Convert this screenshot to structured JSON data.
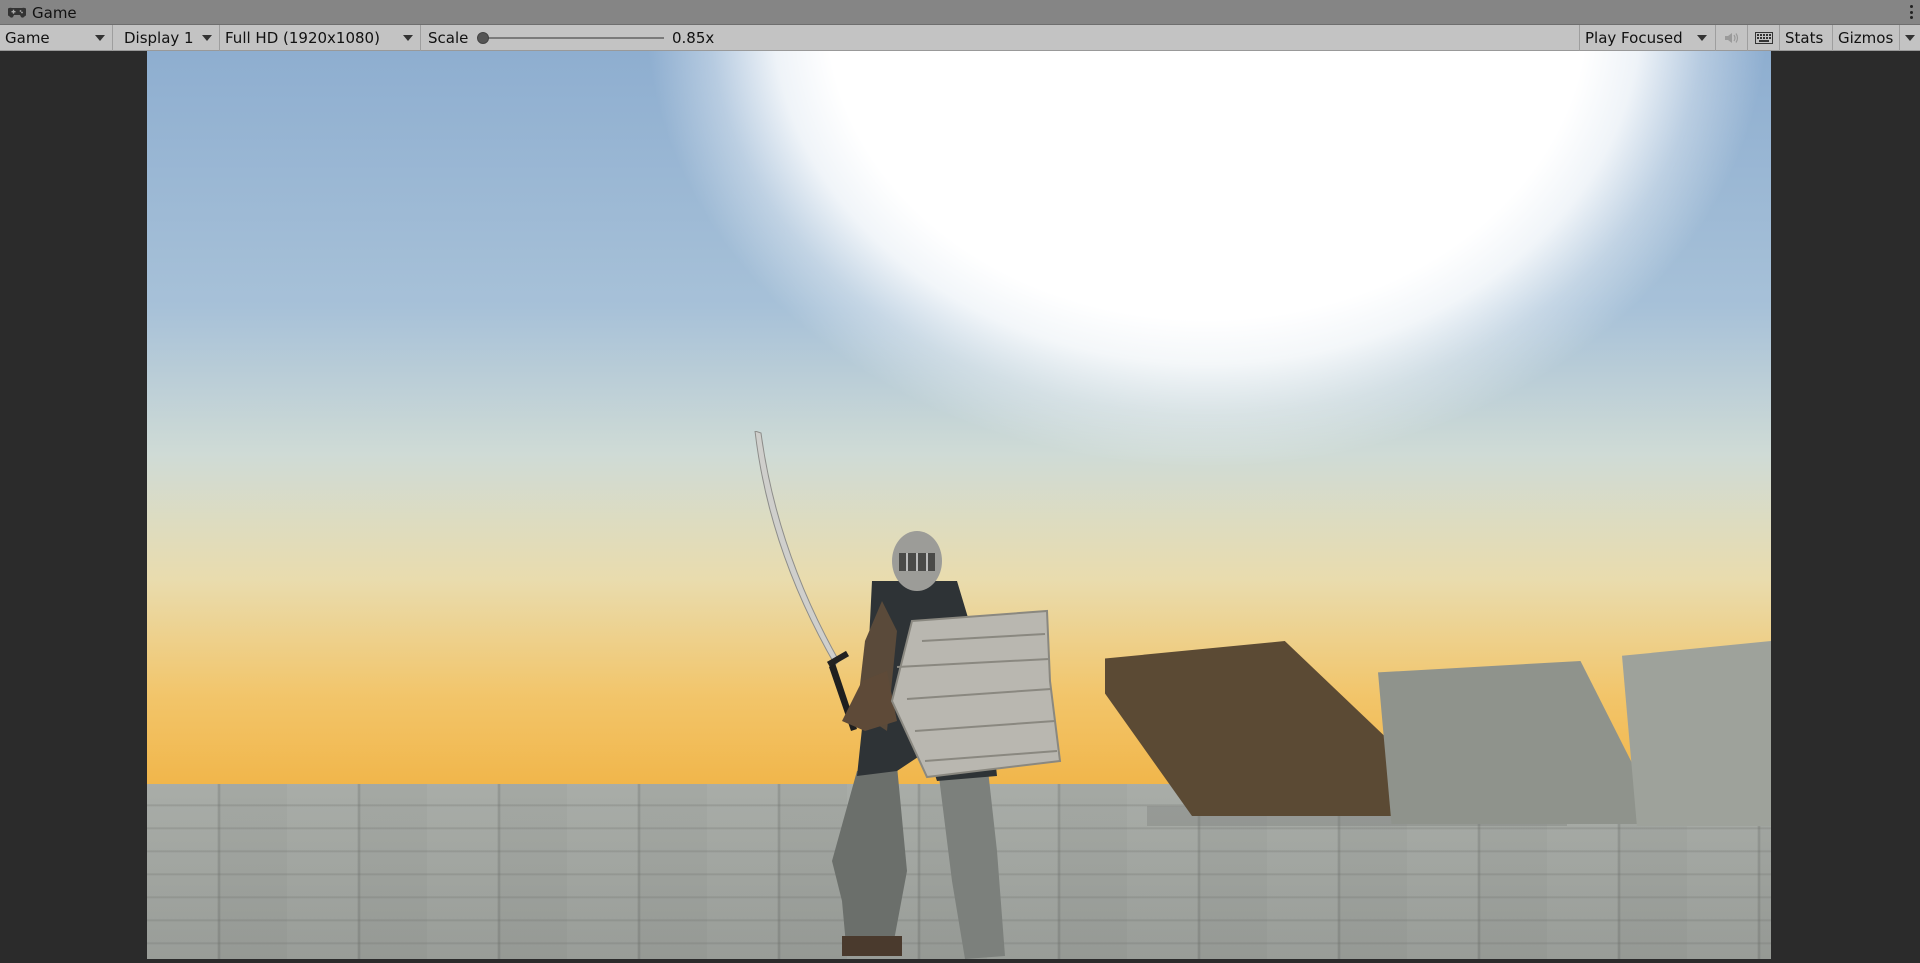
{
  "tab": {
    "label": "Game",
    "icon": "gamepad-icon"
  },
  "toolbar": {
    "view_mode": "Game",
    "display": "Display 1",
    "resolution": "Full HD (1920x1080)",
    "scale_label": "Scale",
    "scale_value": "0.85x",
    "play_mode": "Play Focused",
    "mute_icon": "speaker-icon",
    "keyboard_icon": "keyboard-icon",
    "stats": "Stats",
    "gizmos": "Gizmos"
  },
  "colors": {
    "tabbar": "#858585",
    "toolbar": "#c3c3c3",
    "background": "#2b2b2b"
  }
}
